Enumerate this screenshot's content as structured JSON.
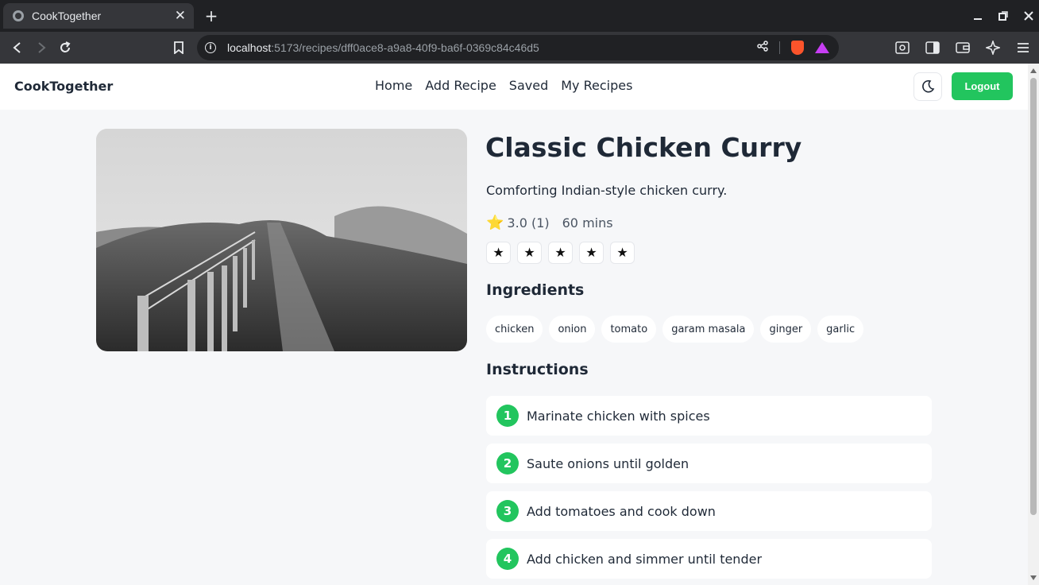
{
  "browser": {
    "tab_title": "CookTogether",
    "url_host": "localhost",
    "url_path": ":5173/recipes/dff0ace8-a9a8-40f9-ba6f-0369c84c46d5"
  },
  "header": {
    "brand": "CookTogether",
    "nav": [
      "Home",
      "Add Recipe",
      "Saved",
      "My Recipes"
    ],
    "logout_label": "Logout"
  },
  "recipe": {
    "title": "Classic Chicken Curry",
    "description": "Comforting Indian-style chicken curry.",
    "rating_icon": "⭐",
    "rating": "3.0 (1)",
    "time": "60 mins",
    "star_buttons": [
      "★",
      "★",
      "★",
      "★",
      "★"
    ],
    "ingredients_heading": "Ingredients",
    "ingredients": [
      "chicken",
      "onion",
      "tomato",
      "garam masala",
      "ginger",
      "garlic"
    ],
    "instructions_heading": "Instructions",
    "instructions": [
      {
        "num": "1",
        "text": "Marinate chicken with spices"
      },
      {
        "num": "2",
        "text": "Saute onions until golden"
      },
      {
        "num": "3",
        "text": "Add tomatoes and cook down"
      },
      {
        "num": "4",
        "text": "Add chicken and simmer until tender"
      }
    ]
  },
  "colors": {
    "accent": "#22c55e",
    "text": "#1f2937",
    "page_bg": "#f6f7f9"
  }
}
